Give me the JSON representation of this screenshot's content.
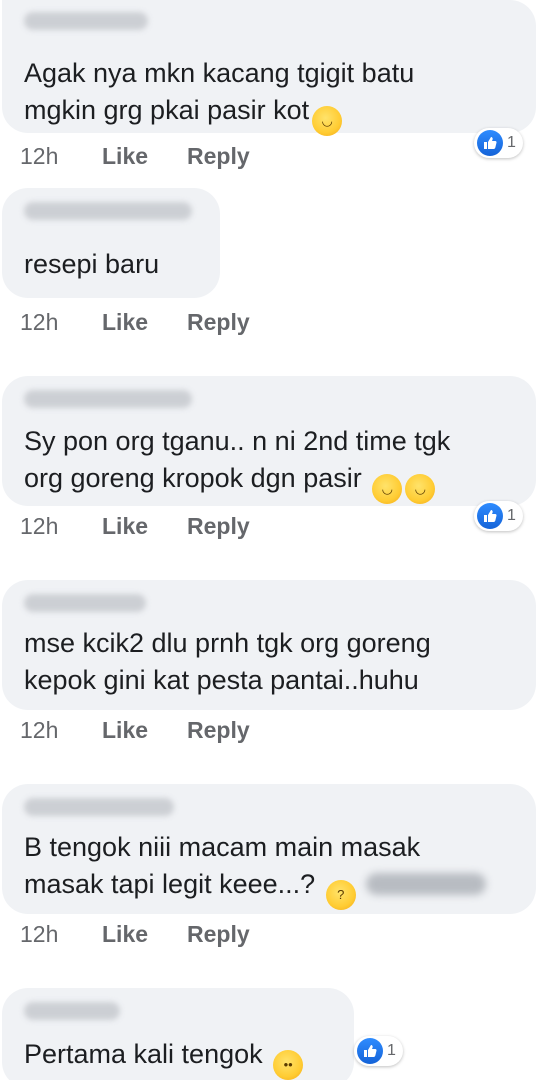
{
  "comments": [
    {
      "text_lines": [
        "Agak nya mkn kacang tgigit batu",
        "mgkin grg pkai pasir kot"
      ],
      "emoji": [
        "grinning-sweat-emoji"
      ],
      "time": "12h",
      "like": "Like",
      "reply": "Reply",
      "reaction_count": "1"
    },
    {
      "text_lines": [
        "resepi baru"
      ],
      "emoji": [],
      "time": "12h",
      "like": "Like",
      "reply": "Reply"
    },
    {
      "text_lines": [
        "Sy pon org tganu.. n ni 2nd time tgk",
        "org goreng kropok dgn pasir"
      ],
      "emoji": [
        "beaming-grin-emoji",
        "beaming-grin-emoji"
      ],
      "time": "12h",
      "like": "Like",
      "reply": "Reply",
      "reaction_count": "1"
    },
    {
      "text_lines": [
        "mse kcik2 dlu prnh tgk org goreng",
        "kepok gini kat pesta pantai..huhu"
      ],
      "emoji": [],
      "time": "12h",
      "like": "Like",
      "reply": "Reply"
    },
    {
      "text_lines": [
        "B tengok niii macam main masak",
        "masak tapi legit keee...?"
      ],
      "emoji": [
        "thinking-emoji"
      ],
      "time": "12h",
      "like": "Like",
      "reply": "Reply"
    },
    {
      "text_lines": [
        "Pertama kali tengok"
      ],
      "emoji": [
        "flushed-emoji"
      ],
      "reaction_count": "1"
    }
  ],
  "colors": {
    "bubble": "#f0f2f5",
    "like_blue": "#1877f2",
    "meta_gray": "#65676b"
  }
}
